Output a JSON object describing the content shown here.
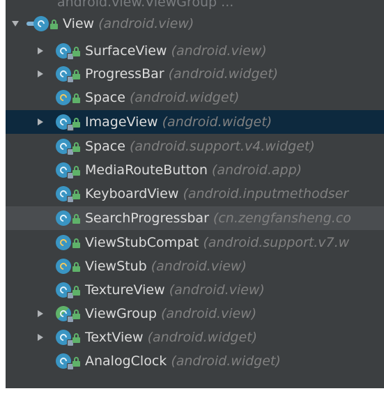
{
  "tree": {
    "top_sliver_text": "android.view.ViewGroup ...",
    "items": [
      {
        "name": "View",
        "package": "(android.view)",
        "expander": "down",
        "depth": 0,
        "icon": "class-icon",
        "state": "normal"
      },
      {
        "name": "SurfaceView",
        "package": "(android.view)",
        "expander": "right",
        "depth": 1,
        "icon": "class-icon",
        "state": "normal"
      },
      {
        "name": "ProgressBar",
        "package": "(android.widget)",
        "expander": "right",
        "depth": 1,
        "icon": "class-icon",
        "state": "normal"
      },
      {
        "name": "Space",
        "package": "(android.widget)",
        "expander": "none",
        "depth": 1,
        "icon": "class-icon",
        "state": "normal"
      },
      {
        "name": "ImageView",
        "package": "(android.widget)",
        "expander": "right",
        "depth": 1,
        "icon": "class-icon",
        "state": "selected"
      },
      {
        "name": "Space",
        "package": "(android.support.v4.widget)",
        "expander": "none",
        "depth": 1,
        "icon": "class-icon",
        "state": "normal"
      },
      {
        "name": "MediaRouteButton",
        "package": "(android.app)",
        "expander": "none",
        "depth": 1,
        "icon": "class-icon",
        "state": "normal"
      },
      {
        "name": "KeyboardView",
        "package": "(android.inputmethodser",
        "expander": "none",
        "depth": 1,
        "icon": "class-icon",
        "state": "normal"
      },
      {
        "name": "SearchProgressbar",
        "package": "(cn.zengfansheng.co",
        "expander": "none",
        "depth": 1,
        "icon": "class-icon",
        "state": "alt"
      },
      {
        "name": "ViewStubCompat",
        "package": "(android.support.v7.w",
        "expander": "none",
        "depth": 1,
        "icon": "class-icon",
        "state": "normal"
      },
      {
        "name": "ViewStub",
        "package": "(android.view)",
        "expander": "none",
        "depth": 1,
        "icon": "class-icon",
        "state": "normal"
      },
      {
        "name": "TextureView",
        "package": "(android.view)",
        "expander": "none",
        "depth": 1,
        "icon": "class-icon",
        "state": "normal"
      },
      {
        "name": "ViewGroup",
        "package": "(android.view)",
        "expander": "right",
        "depth": 1,
        "icon": "class-icon",
        "state": "normal"
      },
      {
        "name": "TextView",
        "package": "(android.widget)",
        "expander": "right",
        "depth": 1,
        "icon": "class-icon",
        "state": "normal"
      },
      {
        "name": "AnalogClock",
        "package": "(android.widget)",
        "expander": "none",
        "depth": 1,
        "icon": "class-icon",
        "state": "normal"
      }
    ]
  },
  "colors": {
    "background": "#3c3f41",
    "selected": "#0d293e",
    "alt_row": "#4a4d50",
    "class_name": "#dcdcdc",
    "package": "#808080",
    "class_icon": "#3a95c3",
    "lock": "#5fb26a"
  }
}
